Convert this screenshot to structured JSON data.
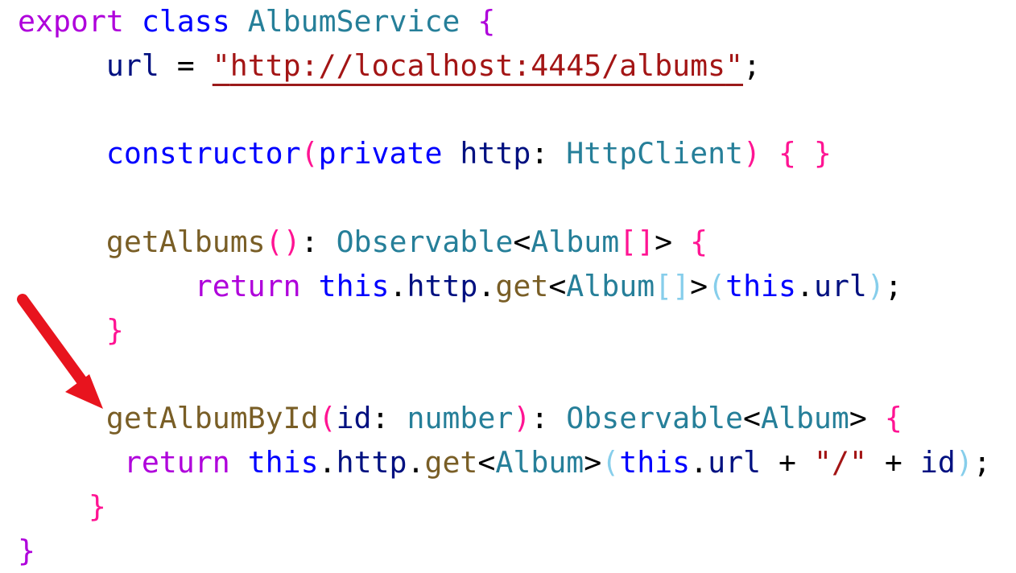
{
  "code": {
    "l1": {
      "export": "export",
      "class": "class",
      "name": "AlbumService",
      "open": "{"
    },
    "l2": {
      "indent": "     ",
      "prop": "url",
      "eq": " = ",
      "q1": "\"",
      "url": "http://localhost:4445/albums",
      "q2": "\"",
      "semi": ";"
    },
    "l4": {
      "indent": "     ",
      "ctor": "constructor",
      "p1": "(",
      "private": "private",
      "param": "http",
      "colon": ": ",
      "ptype": "HttpClient",
      "p2": ")",
      "body": "{ }"
    },
    "l6": {
      "indent": "     ",
      "fn": "getAlbums",
      "parens": "()",
      "colon": ": ",
      "rtype": "Observable",
      "lt": "<",
      "gtype": "Album",
      "brackets": "[]",
      "gt": ">",
      "open": "{"
    },
    "l7": {
      "indent": "          ",
      "ret": "return",
      "this": "this",
      "dot1": ".",
      "http": "http",
      "dot2": ".",
      "get": "get",
      "lt": "<",
      "gtype": "Album",
      "brackets": "[]",
      "gt": ">",
      "p1": "(",
      "this2": "this",
      "dot3": ".",
      "url": "url",
      "p2": ")",
      "semi": ";"
    },
    "l8": {
      "indent": "     ",
      "close": "}"
    },
    "l10": {
      "indent": "     ",
      "fn": "getAlbumById",
      "p1": "(",
      "param": "id",
      "colon": ": ",
      "ptype": "number",
      "p2": ")",
      "colon2": ": ",
      "rtype": "Observable",
      "lt": "<",
      "gtype": "Album",
      "gt": ">",
      "open": "{"
    },
    "l11": {
      "indent": "      ",
      "ret": "return",
      "this": "this",
      "dot1": ".",
      "http": "http",
      "dot2": ".",
      "get": "get",
      "lt": "<",
      "gtype": "Album",
      "gt": ">",
      "p1": "(",
      "this2": "this",
      "dot3": ".",
      "url": "url",
      "plus1": " + ",
      "slash": "\"/\"",
      "plus2": " + ",
      "id": "id",
      "p2": ")",
      "semi": ";"
    },
    "l12": {
      "indent": "    ",
      "close": "}"
    },
    "l13": {
      "close": "}"
    }
  },
  "colors": {
    "keyword_purple": "#af00db",
    "keyword_blue": "#0000ff",
    "type": "#267f99",
    "function": "#795e26",
    "variable": "#001080",
    "string": "#a31515",
    "bracket_level1": "#af00db",
    "bracket_level2": "#ff1493",
    "bracket_level3": "#87ceeb",
    "arrow": "#e8141e",
    "underline": "#9b1b1b"
  },
  "annotation": {
    "icon": "red-arrow-icon"
  }
}
